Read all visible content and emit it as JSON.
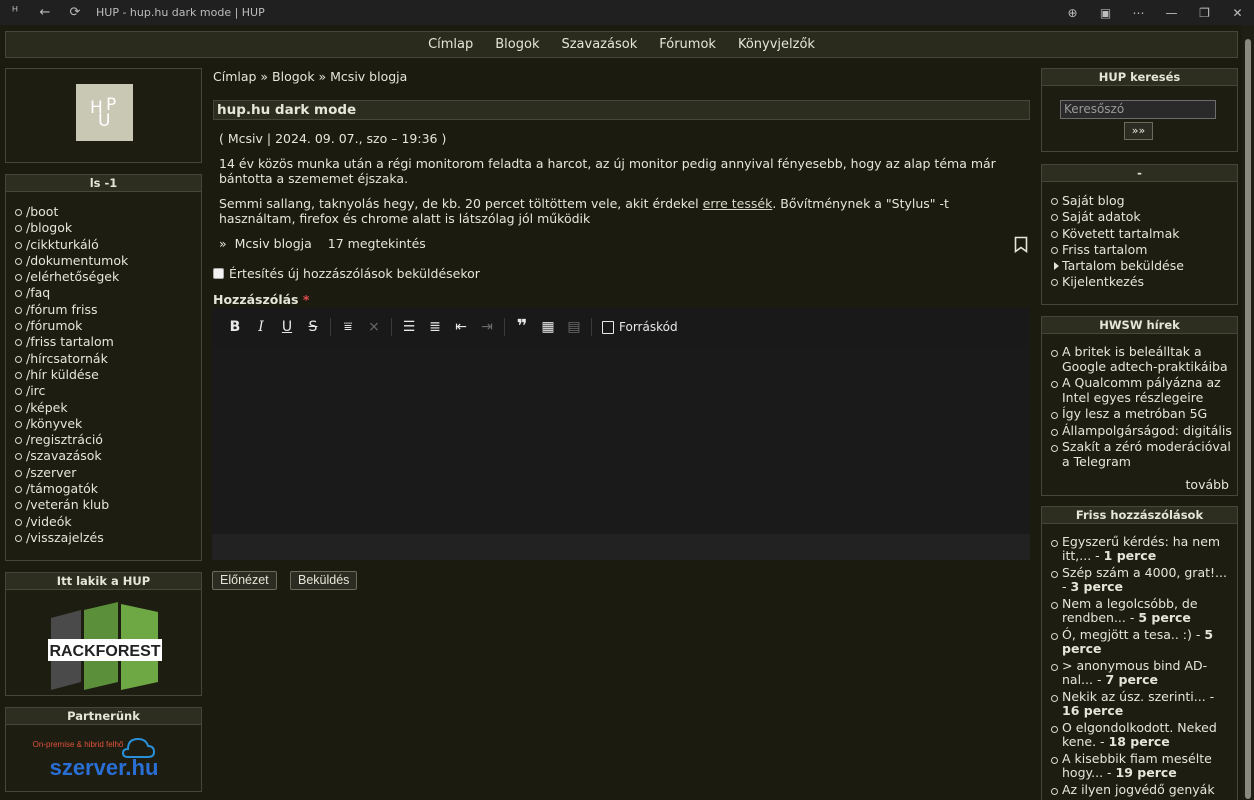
{
  "browser": {
    "title": "HUP - hup.hu dark mode | HUP"
  },
  "topnav": [
    "Címlap",
    "Blogok",
    "Szavazások",
    "Fórumok",
    "Könyvjelzők"
  ],
  "left": {
    "ls_title": "ls -1",
    "ls_items": [
      "/boot",
      "/blogok",
      "/cikkturkáló",
      "/dokumentumok",
      "/elérhetőségek",
      "/faq",
      "/fórum friss",
      "/fórumok",
      "/friss tartalom",
      "/hírcsatornák",
      "/hír küldése",
      "/irc",
      "/képek",
      "/könyvek",
      "/regisztráció",
      "/szavazások",
      "/szerver",
      "/támogatók",
      "/veterán klub",
      "/videók",
      "/visszajelzés"
    ],
    "host_title": "Itt lakik a HUP",
    "host_logo_text": "RACKFOREST",
    "partner_title": "Partnerünk",
    "partner_tagline": "On-premise &\nhibrid felhő",
    "partner_logo_text": "szerver.hu",
    "logo_letters": [
      "H",
      "U",
      "P"
    ]
  },
  "main": {
    "breadcrumb": "Címlap » Blogok » Mcsiv blogja",
    "title": "hup.hu dark mode",
    "meta_open": "(",
    "author": "Mcsiv",
    "date": "| 2024. 09. 07., szo – 19:36 )",
    "para1": "14 év közös munka után a régi monitorom feladta a harcot, az új monitor pedig annyival fényesebb, hogy az alap téma már bántotta a szememet éjszaka.",
    "para2_a": "Semmi sallang, taknyolás hegy, de kb. 20 percet töltöttem vele, akit érdekel ",
    "para2_link": "erre tessék",
    "para2_b": ". Bővítménynek a \"Stylus\" -t használtam, firefox és chrome alatt is látszólag jól működik",
    "blog_link": "Mcsiv blogja",
    "views": "17 megtekintés",
    "notify_label": "Értesítés új hozzászólások beküldésekor",
    "comment_label": "Hozzászólás",
    "required_mark": "*",
    "source_label": "Forráskód",
    "preview_btn": "Előnézet",
    "submit_btn": "Beküldés"
  },
  "right": {
    "search_title": "HUP keresés",
    "search_placeholder": "Keresőszó",
    "search_btn": "»»",
    "user_title": "-",
    "user_items": [
      "Saját blog",
      "Saját adatok",
      "Követett tartalmak",
      "Friss tartalom",
      "Tartalom beküldése",
      "Kijelentkezés"
    ],
    "hwsw_title": "HWSW hírek",
    "hwsw_items": [
      "A britek is beleálltak a Google adtech-praktikáiba",
      "A Qualcomm pályázna az Intel egyes részlegeire",
      "Így lesz a metróban 5G",
      "Állampolgárságod: digitális",
      "Szakít a zéró moderációval a Telegram"
    ],
    "more": "tovább",
    "comments_title": "Friss hozzászólások",
    "comments": [
      {
        "text": "Egyszerű kérdés: ha nem itt,...",
        "time": "1 perce"
      },
      {
        "text": "Szép szám a 4000, grat!...",
        "time": "3 perce"
      },
      {
        "text": "Nem a legolcsóbb, de rendben...",
        "time": "5 perce"
      },
      {
        "text": "Ó, megjött a tesa.. :)",
        "time": "5 perce"
      },
      {
        "text": "> anonymous bind AD-nal...",
        "time": "7 perce"
      },
      {
        "text": "Nekik az úsz. szerinti...",
        "time": "16 perce"
      },
      {
        "text": "O elgondolkodott. Neked kene.",
        "time": "18 perce"
      },
      {
        "text": "A kisebbik fiam mesélte hogy...",
        "time": "19 perce"
      },
      {
        "text": "Az ilyen jogvédő genyák az...",
        "time": ""
      }
    ]
  }
}
